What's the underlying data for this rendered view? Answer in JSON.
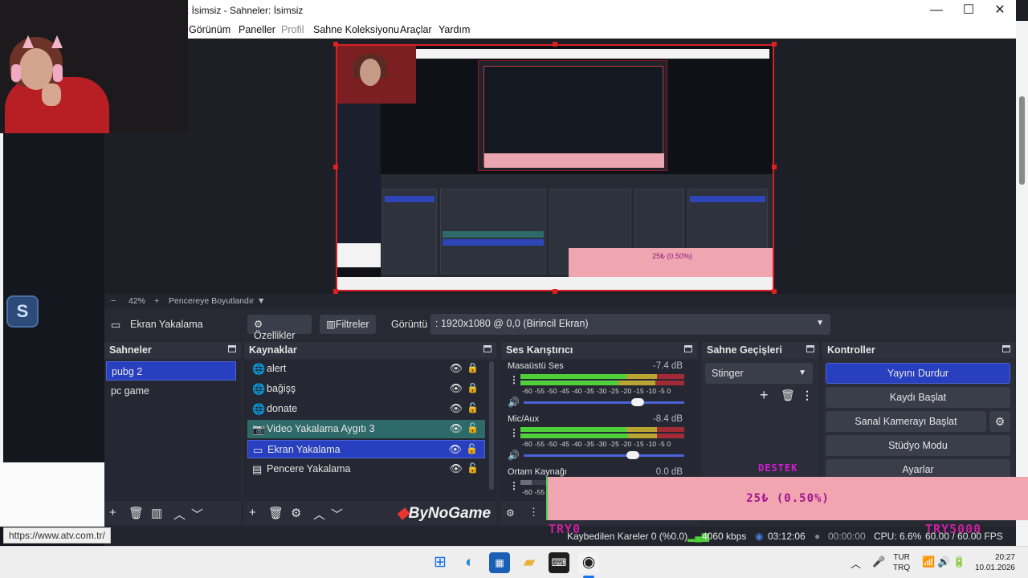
{
  "window": {
    "title": ": İsimsiz - Sahneler: İsimsiz",
    "minimize": "—",
    "maximize": "☐",
    "close": "✕"
  },
  "menu": [
    "Görünüm",
    "Paneller",
    "Profil",
    "Sahne Koleksiyonu",
    "Araçlar",
    "Yardım"
  ],
  "preview": {
    "nested_donation": "25₺ (0.50%)"
  },
  "zoom": {
    "minus": "−",
    "level": "42%",
    "plus": "+",
    "fit_label": "Pencereye Boyutlandır",
    "dropdown": "▼"
  },
  "source_toolbar": {
    "source_name": "Ekran Yakalama",
    "properties": "Özellikler",
    "filters": "Filtreler",
    "display_label": "Görüntü",
    "display_value": ": 1920x1080 @ 0,0 (Birincil Ekran)"
  },
  "scenes": {
    "title": "Sahneler",
    "items": [
      "pubg 2",
      "pc game"
    ]
  },
  "sources": {
    "title": "Kaynaklar",
    "items": [
      {
        "label": "alert",
        "icon": "globe-icon"
      },
      {
        "label": "bağişş",
        "icon": "globe-icon"
      },
      {
        "label": "donate",
        "icon": "globe-icon"
      },
      {
        "label": "Video Yakalama Aygıtı 3",
        "icon": "camera-icon"
      },
      {
        "label": "Ekran Yakalama",
        "icon": "monitor-icon"
      },
      {
        "label": "Pencere Yakalama",
        "icon": "window-icon"
      }
    ],
    "brand": "ByNoGame"
  },
  "mixer": {
    "title": "Ses Karıştırıcı",
    "channels": [
      {
        "name": "Masaüstü Ses",
        "db": "-7.4 dB"
      },
      {
        "name": "Mic/Aux",
        "db": "-8.4 dB"
      },
      {
        "name": "Ortam Kaynağı",
        "db": "0.0 dB"
      }
    ],
    "ticks": "-60  -55  -50  -45  -40  -35  -30  -25  -20  -15  -10   -5   0",
    "ticks_partial": "-60 -55"
  },
  "transitions": {
    "title": "Sahne Geçişleri",
    "selected": "Stinger"
  },
  "controls": {
    "title": "Kontroller",
    "stop_stream": "Yayını Durdur",
    "start_record": "Kaydı Başlat",
    "virtual_cam": "Sanal Kamerayı Başlat",
    "studio_mode": "Stüdyo Modu",
    "settings": "Ayarlar"
  },
  "status": {
    "dropped": "Kaybedilen Kareler 0 (%0.0)",
    "bitrate": "4060 kbps",
    "stream_time": "03:12:06",
    "record_time": "00:00:00",
    "cpu": "CPU: 6.6%",
    "fps": "60.00 / 60.00 FPS"
  },
  "overlay": {
    "donation": "25₺ (0.50%)",
    "destek": "DESTEK",
    "trap_left": "TRY0",
    "trap_right": "TRY5000"
  },
  "browser": {
    "status_url": "https://www.atv.com.tr/"
  },
  "taskbar": {
    "lang_top": "TUR",
    "lang_bottom": "TRQ",
    "time": "20:27",
    "date": "10.01.2026"
  },
  "colors": {
    "accent": "#2840bf",
    "preview_border": "#d81f26",
    "donation_bg": "#f0a5b1"
  }
}
